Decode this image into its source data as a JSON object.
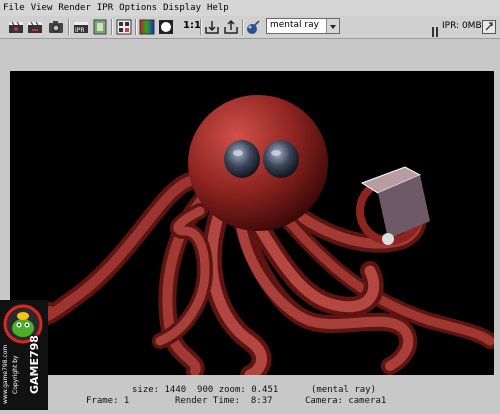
{
  "menu": [
    "File",
    "View",
    "Render",
    "IPR",
    "Options",
    "Display",
    "Help"
  ],
  "toolbar": {
    "one_to_one": "1:1",
    "renderer": "mental ray",
    "ipr_memory": "IPR: 0MB"
  },
  "status": {
    "size_zoom": "size: 1440  900 zoom: 0.451",
    "renderer": "(mental ray)",
    "frame": "Frame: 1",
    "render_time": "Render Time:  8:37",
    "camera": "Camera: camera1"
  },
  "watermark": {
    "brand": "GAME798",
    "copyright": "Copyright by",
    "site": "www.game798.com"
  },
  "icons": [
    "render-icon",
    "redo-render-icon",
    "snapshot-icon",
    "ipr-render-icon",
    "refresh-ipr-icon",
    "region-icon",
    "color-channels-icon",
    "alpha-channel-icon",
    "keep-image-icon",
    "remove-image-icon",
    "render-globals-icon",
    "ipr-pause-icon",
    "close-ipr-icon"
  ],
  "colors": {
    "toolbar_bg": "#d0d0d0",
    "render_bg": "#000000",
    "octopus": "#8e2420"
  }
}
